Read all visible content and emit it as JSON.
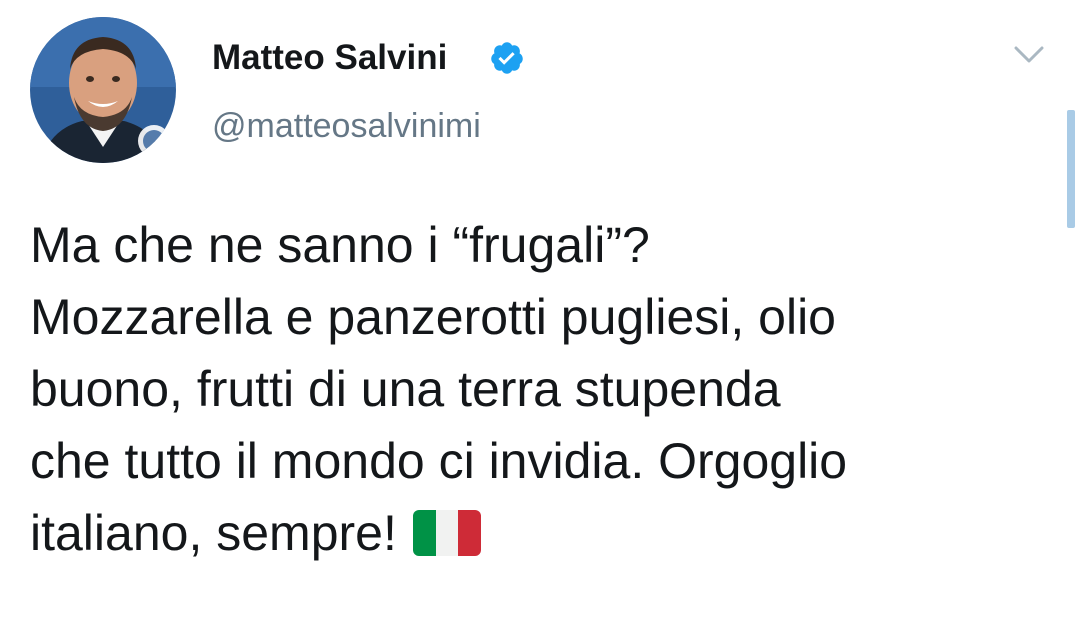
{
  "author": {
    "display_name": "Matteo Salvini",
    "handle": "@matteosalvinimi",
    "verified": true,
    "avatar_icon": "profile-photo"
  },
  "tweet": {
    "lines": [
      "Ma che ne sanno i “frugali”?",
      "Mozzarella e panzerotti pugliesi, olio",
      "buono, frutti di una terra stupenda",
      "che tutto il mondo ci invidia. Orgoglio",
      "italiano, sempre!"
    ],
    "emoji": "flag-italy"
  },
  "controls": {
    "more_icon": "chevron-down-icon"
  },
  "colors": {
    "text": "#14171a",
    "secondary_text": "#657786",
    "verified_blue": "#1da1f2",
    "scrollbar": "#a9cbe6",
    "flag_green": "#009246",
    "flag_white": "#f1f2f1",
    "flag_red": "#ce2b37"
  }
}
